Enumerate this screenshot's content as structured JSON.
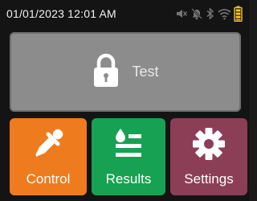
{
  "status_bar": {
    "datetime": "01/01/2023 12:01 AM",
    "icons": [
      "speaker-muted-icon",
      "bell-muted-icon",
      "bluetooth-icon",
      "wifi-icon",
      "battery-icon"
    ],
    "battery_color": "#f3c51f"
  },
  "tiles": {
    "test": {
      "label": "Test",
      "icon": "lock-icon",
      "color": "#8c8c8c"
    },
    "control": {
      "label": "Control",
      "icon": "dropper-icon",
      "color": "#ee7b1e"
    },
    "results": {
      "label": "Results",
      "icon": "results-list-icon",
      "color": "#17a152"
    },
    "settings": {
      "label": "Settings",
      "icon": "gear-icon",
      "color": "#8d3e57"
    }
  }
}
